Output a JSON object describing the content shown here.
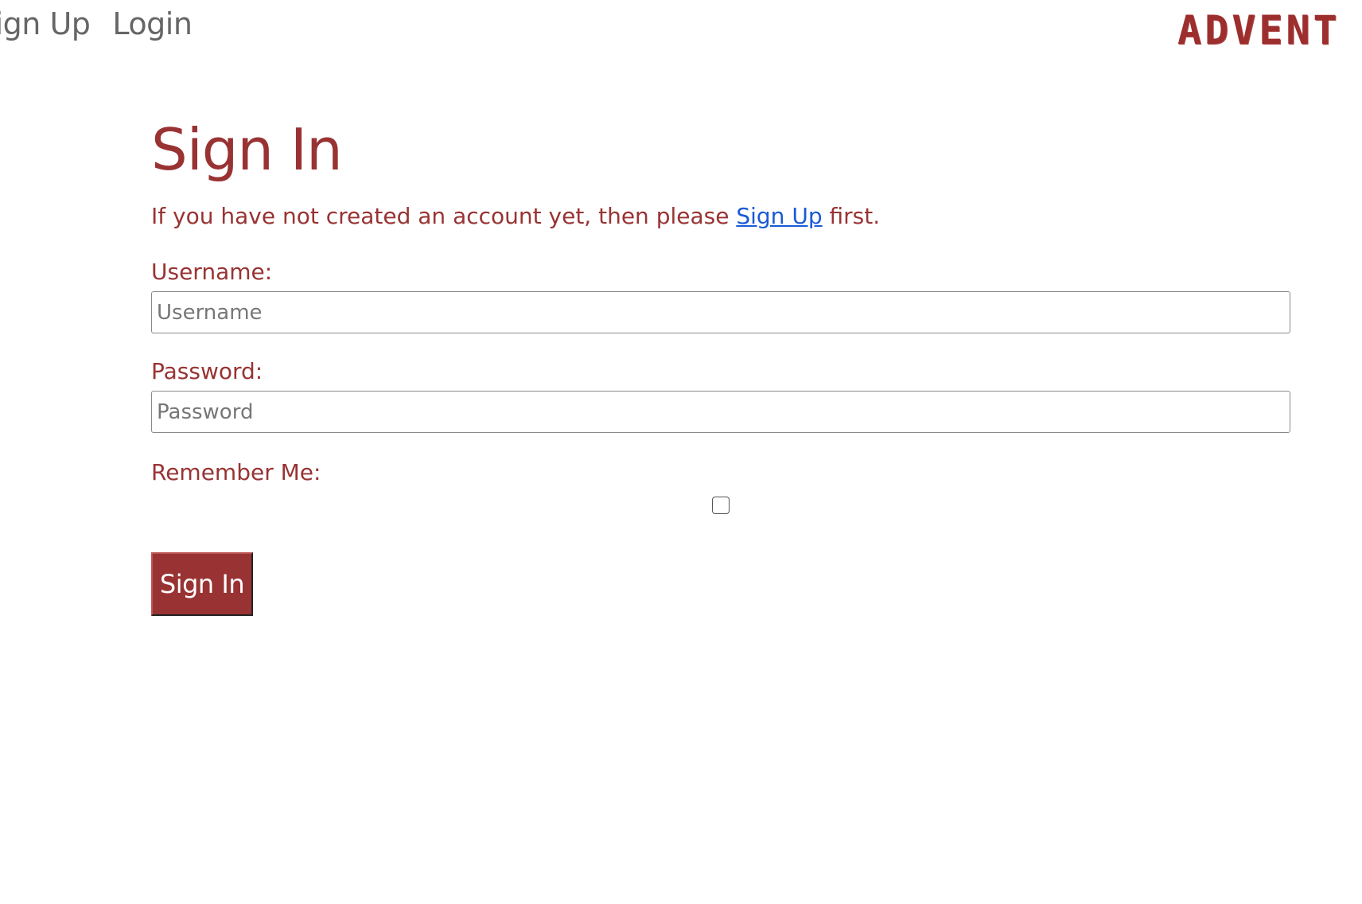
{
  "nav": {
    "signup_label": "Sign Up",
    "login_label": "Login"
  },
  "logo": {
    "text": "ADVENT"
  },
  "form": {
    "title": "Sign In",
    "intro_before": "If you have not created an account yet, then please ",
    "intro_link": "Sign Up",
    "intro_after": " first.",
    "username_label": "Username:",
    "username_placeholder": "Username",
    "username_value": "",
    "password_label": "Password:",
    "password_placeholder": "Password",
    "password_value": "",
    "remember_label": "Remember Me:",
    "remember_checked": false,
    "submit_label": "Sign In"
  },
  "colors": {
    "accent": "#993333",
    "link": "#1a5bd6",
    "nav_text": "#666666"
  }
}
